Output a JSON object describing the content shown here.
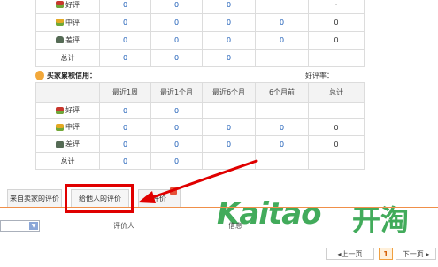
{
  "labels": {
    "good": "好评",
    "mid": "中评",
    "bad": "差评",
    "total": "总计"
  },
  "top_table": {
    "rows": [
      [
        "0",
        "0",
        "0",
        "",
        "·"
      ],
      [
        "0",
        "0",
        "0",
        "0",
        "0"
      ],
      [
        "0",
        "0",
        "0",
        "0",
        "0"
      ],
      [
        "0",
        "0",
        "0",
        "",
        ""
      ]
    ]
  },
  "buyer": {
    "title": "买家累积信用：",
    "rate_label": "好评率："
  },
  "bottom_table": {
    "headers": [
      "",
      "最近1周",
      "最近1个月",
      "最近6个月",
      "6个月前",
      "总计"
    ],
    "rows": [
      [
        "0",
        "0",
        "",
        "",
        ""
      ],
      [
        "0",
        "0",
        "0",
        "0",
        "0"
      ],
      [
        "0",
        "0",
        "0",
        "0",
        "0"
      ],
      [
        "0",
        "0",
        "",
        "",
        ""
      ]
    ]
  },
  "tabs": {
    "from_seller": "来自卖家的评价",
    "to_others": "给他人的评价",
    "third": "评价"
  },
  "columns": {
    "reviewer": "评价人",
    "info": "信息"
  },
  "logo": {
    "latin": "Kaitao",
    "cn": "开淘"
  },
  "pagination": {
    "prev": "◂上一页",
    "current": "1",
    "next": "下一页 ▸"
  },
  "colors": {
    "accent": "#f08f49",
    "highlight": "#e00000",
    "link": "#1f5fb8",
    "logo": "#2ea24a"
  }
}
